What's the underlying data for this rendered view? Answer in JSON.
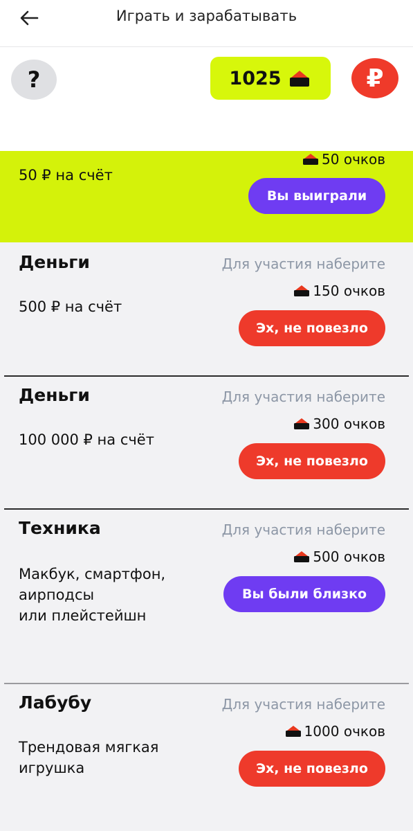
{
  "topbar": {
    "title": "Играть и зарабатывать"
  },
  "header": {
    "help_label": "?",
    "points_value": "1025",
    "ruble_label": "₽"
  },
  "colors": {
    "accent_lime": "#d7f70b",
    "red": "#ee3a2b",
    "purple": "#6f3cf2",
    "muted": "#8d97a6"
  },
  "icons": {
    "back": "arrow-left-icon",
    "points": "treasure-icon",
    "currency": "ruble-icon"
  },
  "prizes": [
    {
      "name": "",
      "description": "50 ₽ на счёт",
      "requirement": "",
      "cost": "50 очков",
      "button": "Вы выиграли",
      "status": "won"
    },
    {
      "name": "Деньги",
      "description": "500 ₽ на счёт",
      "requirement": "Для участия наберите",
      "cost": "150 очков",
      "button": "Эх, не повезло",
      "status": "lost"
    },
    {
      "name": "Деньги",
      "description": "100 000 ₽ на счёт",
      "requirement": "Для участия наберите",
      "cost": "300 очков",
      "button": "Эх, не повезло",
      "status": "lost"
    },
    {
      "name": "Техника",
      "description_lines": [
        "Макбук, смартфон,",
        "аирподсы",
        "или плейстейшн"
      ],
      "requirement": "Для участия наберите",
      "cost": "500 очков",
      "button": "Вы были близко",
      "status": "close"
    },
    {
      "name": "Лабубу",
      "description_lines": [
        "Трендовая мягкая",
        "игрушка"
      ],
      "requirement": "Для участия наберите",
      "cost": "1000 очков",
      "button": "Эх, не повезло",
      "status": "lost"
    }
  ]
}
